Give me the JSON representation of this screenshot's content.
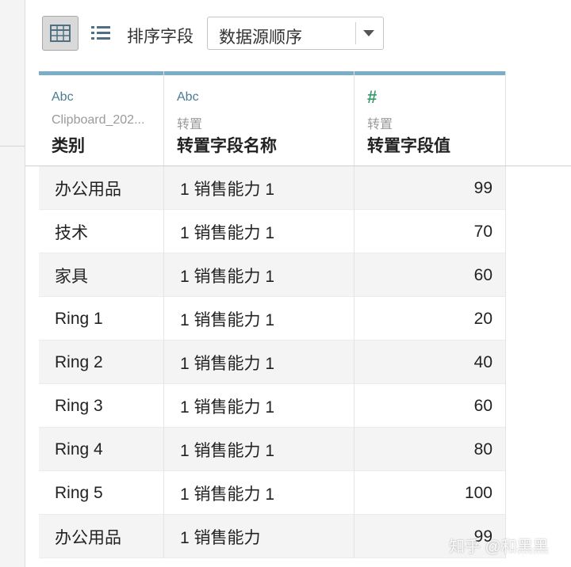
{
  "toolbar": {
    "sort_label": "排序字段",
    "sort_value": "数据源顺序"
  },
  "columns": [
    {
      "type_label": "Abc",
      "source_label": "Clipboard_202...",
      "field_label": "类别",
      "type_color": "#4b7b94"
    },
    {
      "type_label": "Abc",
      "source_label": "转置",
      "field_label": "转置字段名称",
      "type_color": "#4b7b94"
    },
    {
      "type_label": "#",
      "source_label": "转置",
      "field_label": "转置字段值",
      "type_color": "#3a9a6b"
    }
  ],
  "rows": [
    {
      "category": "办公用品",
      "field_name": "1 销售能力 1",
      "value": "99"
    },
    {
      "category": "技术",
      "field_name": "1 销售能力 1",
      "value": "70"
    },
    {
      "category": "家具",
      "field_name": "1 销售能力 1",
      "value": "60"
    },
    {
      "category": "Ring 1",
      "field_name": "1 销售能力 1",
      "value": "20"
    },
    {
      "category": "Ring 2",
      "field_name": "1 销售能力 1",
      "value": "40"
    },
    {
      "category": "Ring 3",
      "field_name": "1 销售能力 1",
      "value": "60"
    },
    {
      "category": "Ring 4",
      "field_name": "1 销售能力 1",
      "value": "80"
    },
    {
      "category": "Ring 5",
      "field_name": "1 销售能力 1",
      "value": "100"
    },
    {
      "category": "办公用品",
      "field_name": "1 销售能力",
      "value": "99"
    }
  ],
  "watermark": "知乎 @和黑黑",
  "colors": {
    "header_bar": "#7aaec8",
    "selected_view_bg": "#d9d9d9",
    "row_alt_bg": "#f4f4f4"
  }
}
